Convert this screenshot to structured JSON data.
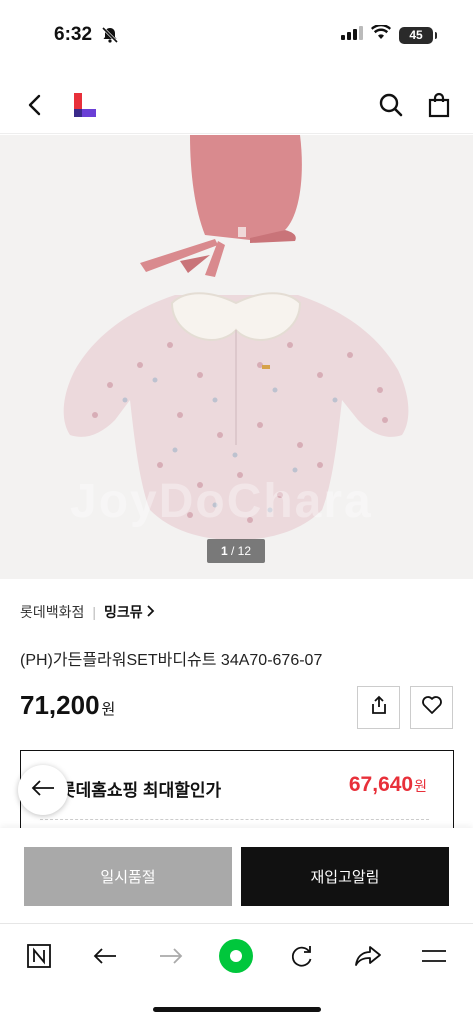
{
  "status_bar": {
    "time": "6:32",
    "battery": "45"
  },
  "header": {
    "logo_icon": "lotte-on-logo-icon"
  },
  "gallery": {
    "current": "1",
    "total": "12",
    "separator": " / ",
    "watermark": "JoyDoChara"
  },
  "product": {
    "store": "롯데백화점",
    "brand": "밍크뮤",
    "title": "(PH)가든플라워SET바디슈트 34A70-676-07",
    "price": "71,200",
    "currency": "원"
  },
  "discount": {
    "label": "롯데홈쇼핑 최대할인가",
    "price": "67,640",
    "currency": "원",
    "color": "#e8303a"
  },
  "actions": {
    "soldout_label": "일시품절",
    "restock_label": "재입고알림"
  },
  "browser_toolbar": {
    "icons": [
      "naver-n-icon",
      "back-arrow-icon",
      "forward-arrow-icon",
      "green-dot-icon",
      "refresh-icon",
      "share-icon",
      "menu-icon"
    ],
    "accent": "#00c73c"
  }
}
